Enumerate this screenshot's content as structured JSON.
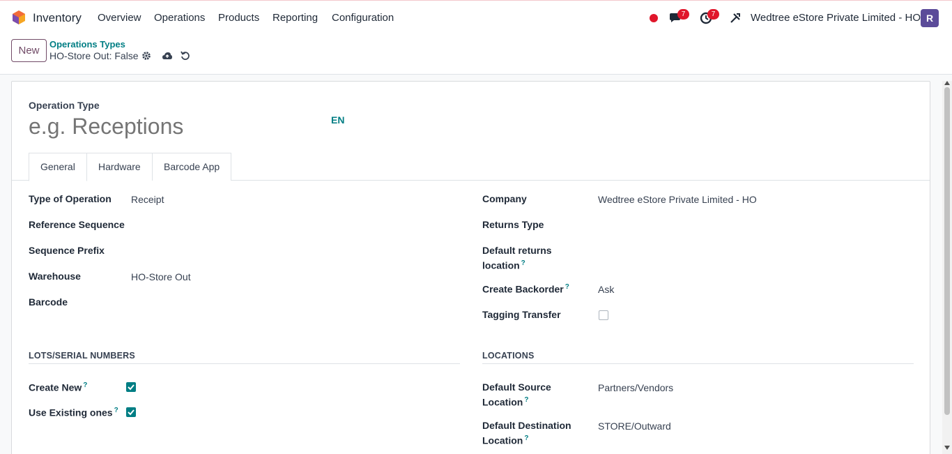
{
  "nav": {
    "app_name": "Inventory",
    "menu": [
      "Overview",
      "Operations",
      "Products",
      "Reporting",
      "Configuration"
    ],
    "messages_count": "7",
    "activities_count": "7",
    "company": "Wedtree eStore Private Limited - HO",
    "avatar_letter": "R"
  },
  "control": {
    "new_label": "New",
    "breadcrumb_parent": "Operations Types",
    "breadcrumb_current": "HO-Store Out: False"
  },
  "form": {
    "title_label": "Operation Type",
    "name_placeholder": "e.g. Receptions",
    "lang": "EN",
    "tabs": [
      "General",
      "Hardware",
      "Barcode App"
    ],
    "left": {
      "type_of_operation_label": "Type of Operation",
      "type_of_operation_value": "Receipt",
      "reference_sequence_label": "Reference Sequence",
      "sequence_prefix_label": "Sequence Prefix",
      "warehouse_label": "Warehouse",
      "warehouse_value": "HO-Store Out",
      "barcode_label": "Barcode"
    },
    "right": {
      "company_label": "Company",
      "company_value": "Wedtree eStore Private Limited - HO",
      "returns_type_label": "Returns Type",
      "default_returns_label_1": "Default returns",
      "default_returns_label_2": "location",
      "create_backorder_label": "Create Backorder",
      "create_backorder_value": "Ask",
      "tagging_transfer_label": "Tagging Transfer"
    },
    "lots": {
      "section": "LOTS/SERIAL NUMBERS",
      "create_new_label": "Create New",
      "use_existing_label": "Use Existing ones"
    },
    "locations": {
      "section": "LOCATIONS",
      "source_label_1": "Default Source",
      "source_label_2": "Location",
      "source_value": "Partners/Vendors",
      "dest_label_1": "Default Destination",
      "dest_label_2": "Location",
      "dest_value": "STORE/Outward"
    },
    "help_mark": "?"
  },
  "colors": {
    "brand": "#714b67",
    "accent": "#017e84",
    "badge": "#e0162b"
  }
}
